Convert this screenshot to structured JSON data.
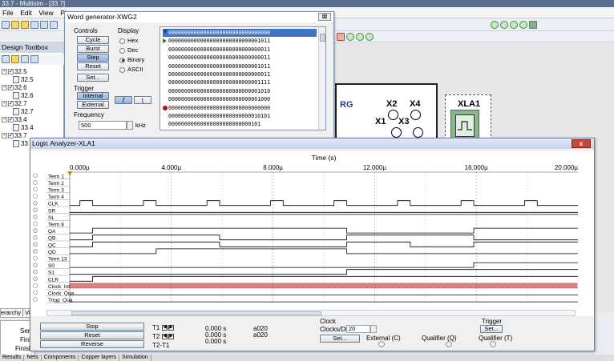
{
  "multisim": {
    "title": "33.7 - Multisim - [33.7]",
    "menu": [
      "File",
      "Edit",
      "View",
      "Place"
    ],
    "design_toolbox": {
      "title": "Design Toolbox",
      "tree": [
        {
          "label": "32.5",
          "type": "folder"
        },
        {
          "label": "32.5",
          "type": "doc"
        },
        {
          "label": "32.6",
          "type": "folder"
        },
        {
          "label": "32.6",
          "type": "doc"
        },
        {
          "label": "32.7",
          "type": "folder"
        },
        {
          "label": "32.7",
          "type": "doc"
        },
        {
          "label": "33.4",
          "type": "folder"
        },
        {
          "label": "33.4",
          "type": "doc"
        },
        {
          "label": "33.7",
          "type": "folder"
        },
        {
          "label": "33",
          "type": "doc"
        }
      ]
    },
    "schematic": {
      "rg_label": "RG",
      "probes": [
        "X2",
        "X4",
        "X1",
        "X3"
      ],
      "xla_label": "XLA1"
    },
    "bottom": {
      "hier_tab": "erarchy",
      "vis_tab": "Vi",
      "left_lines": [
        "Ser",
        "Fini",
        "Finish"
      ],
      "status_tabs": [
        "Results",
        "Nets",
        "Components",
        "Copper layers",
        "Simulation"
      ]
    }
  },
  "word_generator": {
    "title": "Word generator-XWG2",
    "close": "⊠",
    "controls": {
      "title": "Controls",
      "buttons": [
        "Cycle",
        "Burst",
        "Step",
        "Reset"
      ],
      "set": "Set..."
    },
    "display": {
      "title": "Display",
      "options": [
        "Hex",
        "Dec",
        "Binary",
        "ASCII"
      ],
      "selected": "Binary"
    },
    "trigger": {
      "title": "Trigger",
      "buttons": [
        "Internal",
        "External"
      ]
    },
    "frequency": {
      "title": "Frequency",
      "value": "500",
      "unit": "kHz"
    },
    "words": [
      {
        "value": "00000000000000000000000000000000",
        "marker": "cursor",
        "selected": true
      },
      {
        "value": "00000000000000000000000000001011",
        "marker": "current"
      },
      {
        "value": "00000000000000000000000000000011",
        "marker": ""
      },
      {
        "value": "00000000000000000000000000000011",
        "marker": ""
      },
      {
        "value": "00000000000000000000000000001011",
        "marker": ""
      },
      {
        "value": "00000000000000000000000000000011",
        "marker": ""
      },
      {
        "value": "00000000000000000000000000001111",
        "marker": ""
      },
      {
        "value": "00000000000000000000000000001010",
        "marker": ""
      },
      {
        "value": "00000000000000000000000000001000",
        "marker": ""
      },
      {
        "value": "00000000000000000000000000000000",
        "marker": "breakpoint"
      },
      {
        "value": "00000000000000000000000000010101",
        "marker": ""
      },
      {
        "value": "00000000000000000000000000101",
        "marker": ""
      }
    ]
  },
  "logic_analyzer": {
    "title": "Logic Analyzer-XLA1",
    "close": "x",
    "axis_title": "Time (s)",
    "time_ticks": [
      "0.000µ",
      "4.000µ",
      "8.000µ",
      "12.000µ",
      "16.000µ",
      "20.000µ"
    ],
    "channels": [
      "Term 1",
      "Term 2",
      "Term 3",
      "Term 4",
      "CLK",
      "SR",
      "SL",
      "Term 8",
      "QA",
      "QB",
      "QC",
      "QD",
      "Term 13",
      "S0",
      "S1",
      "CLR",
      "Clock_Int",
      "Clock_Qua",
      "Trigg_Qua"
    ],
    "controls": {
      "stop": "Stop",
      "reset": "Reset",
      "reverse": "Reverse"
    },
    "cursors": {
      "t1_label": "T1",
      "t2_label": "T2",
      "dt_label": "T2-T1",
      "t1_time": "0.000 s",
      "t2_time": "0.000 s",
      "dt_time": "0.000 s",
      "t1_value": "a020",
      "t2_value": "a020"
    },
    "clock": {
      "title": "Clock",
      "clocks_div_label": "Clocks/Div",
      "clocks_div_value": "20",
      "set": "Set...",
      "external": "External (C)",
      "qualifier": "Qualifier (Q)"
    },
    "trigger": {
      "title": "Trigger",
      "set": "Set...",
      "qualifier": "Qualifier (T)"
    },
    "waveform_colors": {
      "signal": "#000000",
      "clock_int": "#c0302b",
      "grid": "#9aa3ad"
    }
  }
}
